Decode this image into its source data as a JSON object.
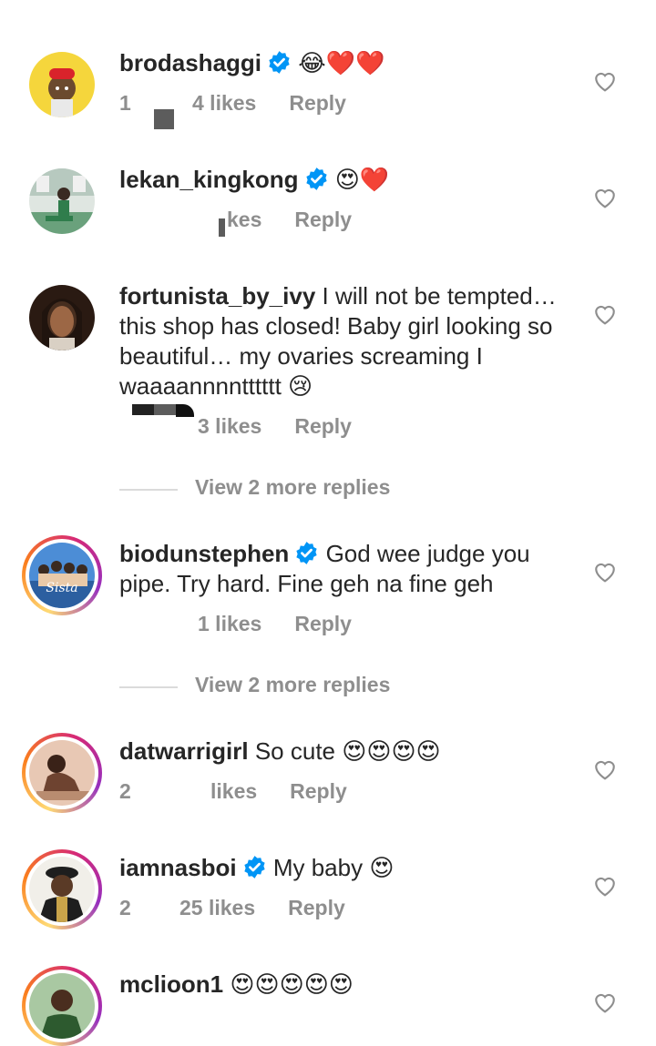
{
  "comments": [
    {
      "username": "brodashaggi",
      "verified": true,
      "text": "",
      "emoji": "😂❤️❤️",
      "time": "1",
      "likes": "4 likes",
      "reply": "Reply"
    },
    {
      "username": "lekan_kingkong",
      "verified": true,
      "text": "",
      "emoji": "😍❤️",
      "time": "",
      "likes": "kes",
      "reply": "Reply"
    },
    {
      "username": "fortunista_by_ivy",
      "verified": false,
      "text": "I will not be tempted… this shop has closed! Baby girl looking so beautiful… my ovaries screaming I waaaannnntttttt",
      "emoji": "😢",
      "time": "",
      "likes": "3 likes",
      "reply": "Reply",
      "view_more": "View 2 more replies"
    },
    {
      "username": "biodunstephen",
      "verified": true,
      "text": "God wee judge you pipe. Try hard. Fine geh na fine geh",
      "emoji": "",
      "time": "",
      "likes": "1 likes",
      "reply": "Reply",
      "view_more": "View 2 more replies",
      "avatar_caption": "Sista"
    },
    {
      "username": "datwarrigirl",
      "verified": false,
      "text": "So cute",
      "emoji": "😍😍😍😍",
      "time": "2",
      "likes": "likes",
      "reply": "Reply"
    },
    {
      "username": "iamnasboi",
      "verified": true,
      "text": "My baby",
      "emoji": "😍",
      "time": "2",
      "likes": "25 likes",
      "reply": "Reply"
    },
    {
      "username": "mclioon1",
      "verified": false,
      "text": "",
      "emoji": "😍😍😍😍😍",
      "time": "",
      "likes": "",
      "reply": ""
    }
  ],
  "colors": {
    "text": "#262626",
    "meta": "#8e8e8e",
    "verified": "#0095f6",
    "divider": "#dbdbdb"
  },
  "icons": {
    "like": "heart-outline-icon",
    "verified": "verified-badge-icon"
  }
}
